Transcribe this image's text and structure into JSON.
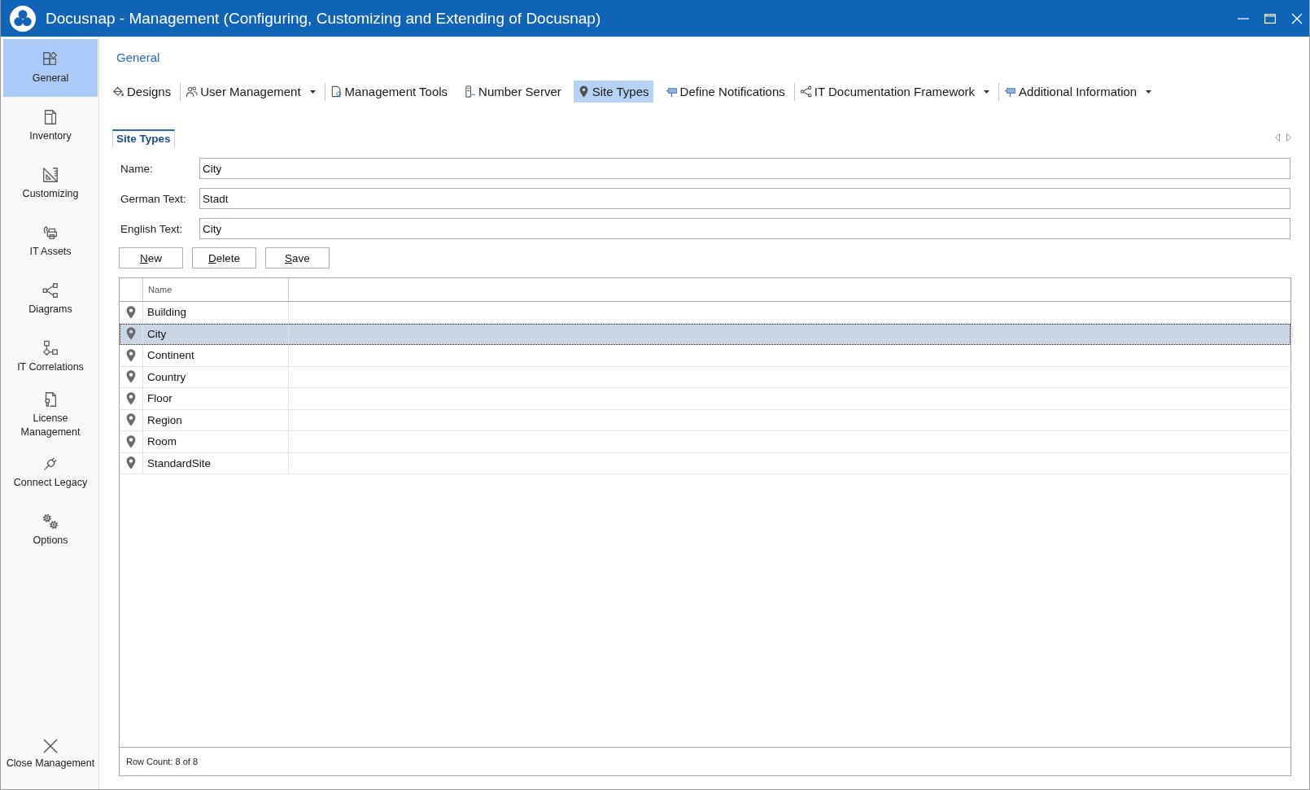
{
  "window": {
    "title": "Docusnap - Management (Configuring, Customizing and Extending of Docusnap)"
  },
  "sidebar": {
    "items": [
      {
        "label": "General",
        "selected": true
      },
      {
        "label": "Inventory",
        "selected": false
      },
      {
        "label": "Customizing",
        "selected": false
      },
      {
        "label": "IT Assets",
        "selected": false
      },
      {
        "label": "Diagrams",
        "selected": false
      },
      {
        "label": "IT Correlations",
        "selected": false
      },
      {
        "label": "License Management",
        "selected": false
      },
      {
        "label": "Connect Legacy",
        "selected": false
      },
      {
        "label": "Options",
        "selected": false
      }
    ],
    "close_button": {
      "label": "Close Management"
    }
  },
  "ribbon": {
    "heading": "General",
    "groups": [
      {
        "items": [
          {
            "label": "Designs",
            "selected": false,
            "dropdown": false
          }
        ]
      },
      {
        "items": [
          {
            "label": "User Management",
            "selected": false,
            "dropdown": true
          }
        ]
      },
      {
        "items": [
          {
            "label": "Management Tools",
            "selected": false,
            "dropdown": false
          },
          {
            "label": "Number Server",
            "selected": false,
            "dropdown": false
          },
          {
            "label": "Site Types",
            "selected": true,
            "dropdown": false
          },
          {
            "label": "Define Notifications",
            "selected": false,
            "dropdown": false
          }
        ]
      },
      {
        "items": [
          {
            "label": "IT Documentation Framework",
            "selected": false,
            "dropdown": true
          }
        ]
      },
      {
        "items": [
          {
            "label": "Additional Information",
            "selected": false,
            "dropdown": true
          }
        ]
      }
    ]
  },
  "panel": {
    "tabs": [
      {
        "label": "Site Types",
        "selected": true
      }
    ],
    "form": {
      "fields": [
        {
          "label": "Name:",
          "value": "City"
        },
        {
          "label": "German Text:",
          "value": "Stadt"
        },
        {
          "label": "English Text:",
          "value": "City"
        }
      ],
      "buttons": [
        "New",
        "Delete",
        "Save"
      ]
    },
    "table": {
      "columns": [
        "Name"
      ],
      "rows": [
        {
          "name": "Building",
          "selected": false
        },
        {
          "name": "City",
          "selected": true
        },
        {
          "name": "Continent",
          "selected": false
        },
        {
          "name": "Country",
          "selected": false
        },
        {
          "name": "Floor",
          "selected": false
        },
        {
          "name": "Region",
          "selected": false
        },
        {
          "name": "Room",
          "selected": false
        },
        {
          "name": "StandardSite",
          "selected": false
        }
      ],
      "footer": "Row Count: 8 of 8"
    }
  }
}
